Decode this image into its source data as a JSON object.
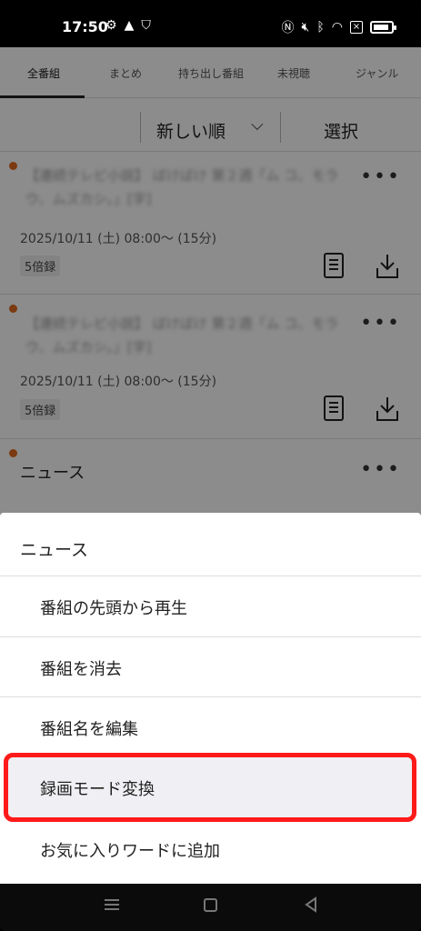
{
  "status_bar": {
    "time": "17:50",
    "left_icons": [
      "settings-sync-icon",
      "warning-icon",
      "shield-icon"
    ],
    "right_icons": [
      "nfc-icon",
      "mute-icon",
      "bluetooth-icon",
      "wifi-icon",
      "close-box-icon",
      "battery-icon"
    ]
  },
  "tabs": {
    "items": [
      {
        "label": "全番組"
      },
      {
        "label": "まとめ"
      },
      {
        "label": "持ち出し番組"
      },
      {
        "label": "未視聴"
      },
      {
        "label": "ジャンル"
      }
    ],
    "active_index": 0
  },
  "sort": {
    "label": "新しい順",
    "select_label": "選択"
  },
  "recordings": [
    {
      "title_blurred": "【連続テレビ小説】 ばけばけ 第２週「ム コ、モラウ、ムズカシ。」[字]",
      "date": "2025/10/11 (土) 08:00～ (15分)",
      "badge": "5倍録"
    },
    {
      "title_blurred": "【連続テレビ小説】 ばけばけ 第２週「ム コ、モラウ、ムズカシ。」[字]",
      "date": "2025/10/11 (土) 08:00～ (15分)",
      "badge": "5倍録"
    },
    {
      "title": "ニュース"
    }
  ],
  "sheet": {
    "title": "ニュース",
    "items": [
      {
        "label": "番組の先頭から再生"
      },
      {
        "label": "番組を消去"
      },
      {
        "label": "番組名を編集"
      },
      {
        "label": "録画モード変換"
      },
      {
        "label": "お気に入りワードに追加"
      }
    ],
    "highlighted_index": 3,
    "highlight_color": "#ff1a1a"
  },
  "colors": {
    "unread_dot": "#e06a1c"
  }
}
